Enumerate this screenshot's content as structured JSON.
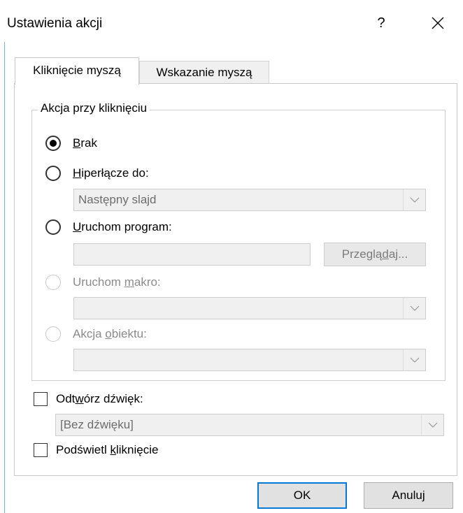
{
  "dialog": {
    "title": "Ustawienia akcji",
    "help_glyph": "?"
  },
  "tabs": [
    {
      "label": "Kliknięcie myszą",
      "active": true
    },
    {
      "label": "Wskazanie myszą",
      "active": false
    }
  ],
  "group": {
    "legend": "Akcja przy kliknięciu",
    "none": {
      "label": "Brak",
      "checked": true
    },
    "hyperlink": {
      "label": "Hiperłącze do:",
      "checked": false,
      "combo_value": "Następny slajd"
    },
    "run_program": {
      "label": "Uruchom program:",
      "checked": false,
      "text_value": "",
      "browse_label": "Przeglądaj..."
    },
    "run_macro": {
      "label": "Uruchom makro:",
      "checked": false,
      "enabled": false,
      "combo_value": ""
    },
    "object_action": {
      "label": "Akcja obiektu:",
      "checked": false,
      "enabled": false,
      "combo_value": ""
    }
  },
  "play_sound": {
    "label": "Odtwórz dźwięk:",
    "checked": false,
    "combo_value": "[Bez dźwięku]"
  },
  "highlight_click": {
    "label": "Podświetl kliknięcie",
    "checked": false
  },
  "buttons": {
    "ok": "OK",
    "cancel": "Anuluj"
  },
  "colors": {
    "accent": "#0078d7",
    "disabled_text": "#8a8a8a",
    "field_bg": "#f0f0f0"
  },
  "icons": {
    "close": "close-icon",
    "dropdown": "chevron-down-icon"
  }
}
